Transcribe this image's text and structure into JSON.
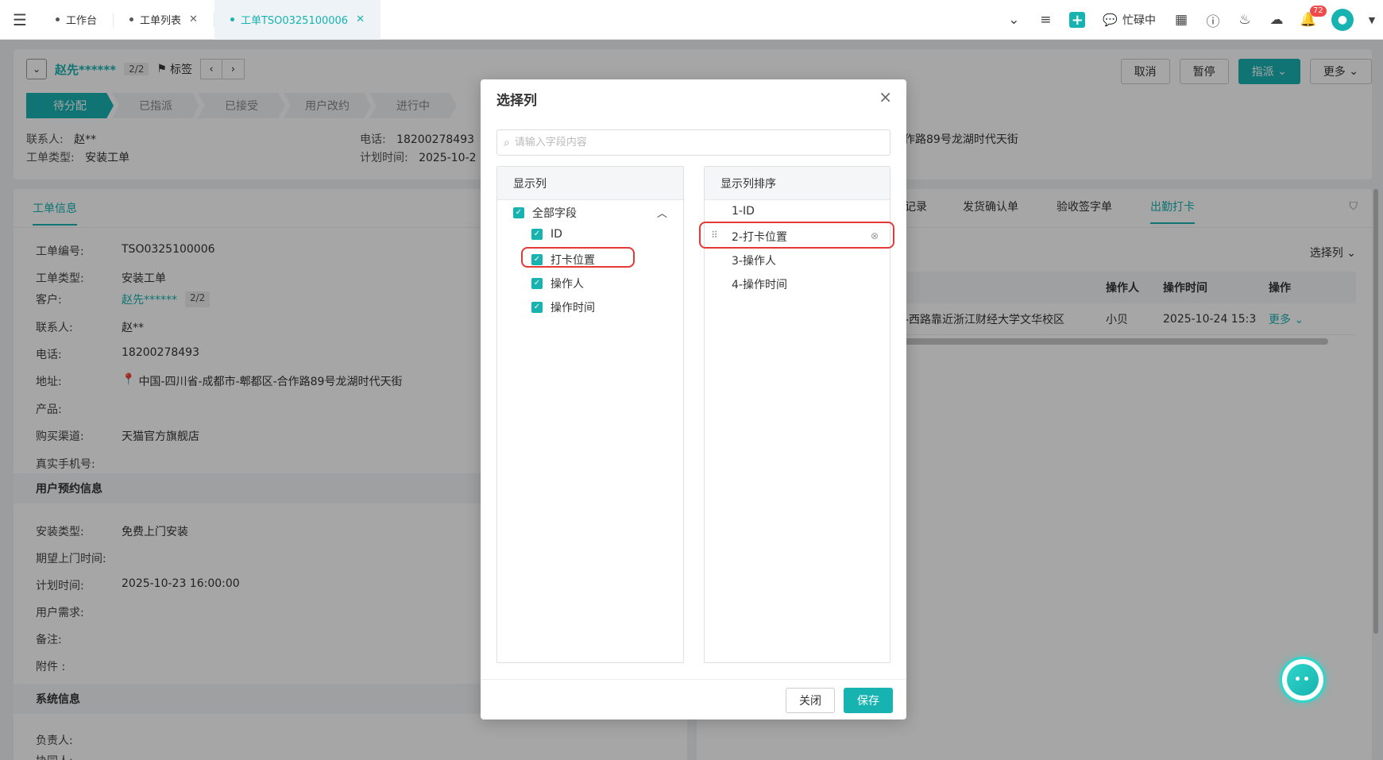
{
  "topbar": {
    "tabs": [
      {
        "label": "工作台",
        "closable": false,
        "active": false
      },
      {
        "label": "工单列表",
        "closable": true,
        "active": false
      },
      {
        "label": "工单TSO0325100006",
        "closable": true,
        "active": true
      }
    ],
    "status": "忙碌中",
    "notification_count": "72"
  },
  "header": {
    "customer_name": "赵先******",
    "pager": "2/2",
    "tag_label": "标签",
    "actions": {
      "cancel": "取消",
      "pause": "暂停",
      "assign": "指派",
      "more": "更多"
    },
    "steps": [
      "待分配",
      "已指派",
      "已接受",
      "用户改约",
      "进行中"
    ],
    "info": {
      "contact_key": "联系人:",
      "contact_val": "赵**",
      "type_key": "工单类型:",
      "type_val": "安装工单",
      "phone_key": "电话:",
      "phone_val": "18200278493",
      "plan_key": "计划时间:",
      "plan_val": "2025-10-2",
      "address_fragment": "作路89号龙湖时代天街"
    }
  },
  "left_panel": {
    "tab": "工单信息",
    "fields": [
      {
        "k": "工单编号:",
        "v": "TSO0325100006"
      },
      {
        "k": "工单类型:",
        "v": "安装工单"
      },
      {
        "k": "客户:",
        "v": "赵先******"
      },
      {
        "k": "联系人:",
        "v": "赵**"
      },
      {
        "k": "电话:",
        "v": "18200278493"
      },
      {
        "k": "地址:",
        "v": "中国-四川省-成都市-郫都区-合作路89号龙湖时代天街"
      },
      {
        "k": "产品:",
        "v": ""
      },
      {
        "k": "购买渠道:",
        "v": "天猫官方旗舰店"
      },
      {
        "k": "真实手机号:",
        "v": ""
      }
    ],
    "customer_pager": "2/2",
    "section_appointment": "用户预约信息",
    "appointment_fields": [
      {
        "k": "安装类型:",
        "v": "免费上门安装"
      },
      {
        "k": "期望上门时间:",
        "v": ""
      },
      {
        "k": "计划时间:",
        "v": "2025-10-23 16:00:00"
      },
      {
        "k": "用户需求:",
        "v": ""
      },
      {
        "k": "备注:",
        "v": ""
      },
      {
        "k": "附件 :",
        "v": ""
      }
    ],
    "section_system": "系统信息",
    "system_fields": [
      {
        "k": "负责人:",
        "v": ""
      },
      {
        "k": "协同人:",
        "v": ""
      }
    ]
  },
  "right_panel": {
    "tabs": [
      "记录",
      "发货确认单",
      "验收签字单",
      "出勤打卡"
    ],
    "active_tab": "出勤打卡",
    "choose_columns": "选择列",
    "table": {
      "headers": [
        "操作人",
        "操作时间",
        "操作"
      ],
      "row": {
        "location": "-西路靠近浙江财经大学文华校区",
        "operator": "小贝",
        "time": "2025-10-24 15:3",
        "action": "更多"
      }
    }
  },
  "modal": {
    "title": "选择列",
    "search_placeholder": "请输入字段内容",
    "left_header": "显示列",
    "all_fields": "全部字段",
    "fields": [
      "ID",
      "打卡位置",
      "操作人",
      "操作时间"
    ],
    "right_header": "显示列排序",
    "sorted": [
      "1-ID",
      "2-打卡位置",
      "3-操作人",
      "4-操作时间"
    ],
    "close_label": "关闭",
    "save_label": "保存"
  },
  "colors": {
    "accent": "#17b3b1",
    "highlight": "#e53935"
  }
}
